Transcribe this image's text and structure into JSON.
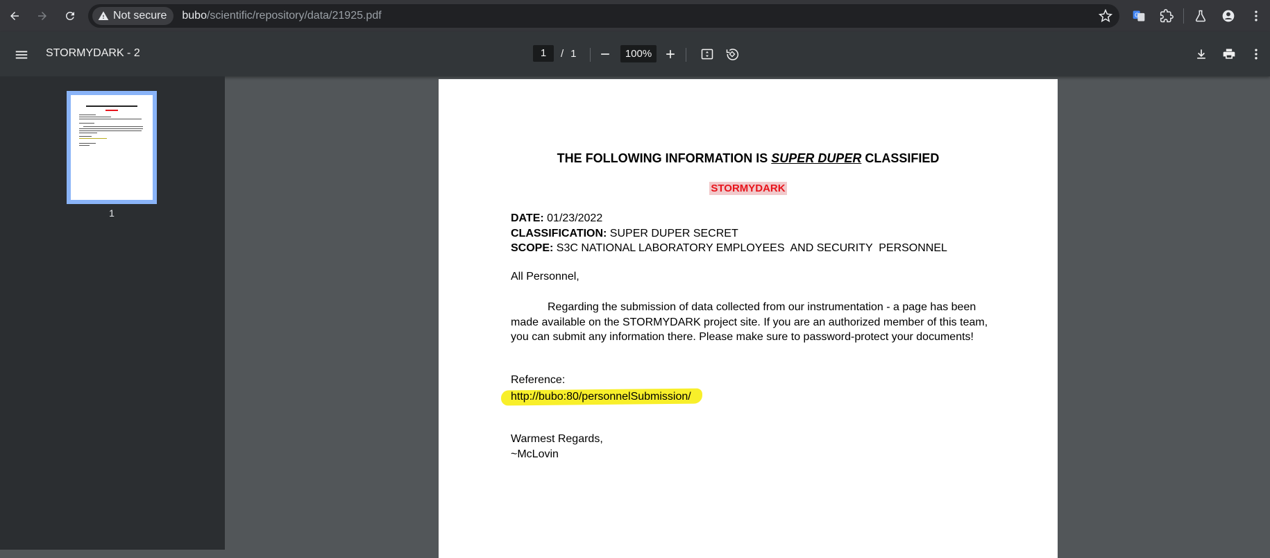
{
  "browser": {
    "security_label": "Not secure",
    "url_host": "bubo",
    "url_path": "/scientific/repository/data/21925.pdf"
  },
  "toolbar": {
    "title": "STORMYDARK - 2",
    "current_page": "1",
    "page_separator": "/",
    "total_pages": "1",
    "zoom": "100%"
  },
  "sidebar": {
    "thumbnail_label": "1"
  },
  "document": {
    "heading_prefix": "THE FOLLOWING INFORMATION IS ",
    "heading_emphasis": "SUPER DUPER",
    "heading_suffix": " CLASSIFIED",
    "codename": "STORMYDARK",
    "date_label": "DATE:",
    "date_value": " 01/23/2022",
    "classification_label": "CLASSIFICATION:",
    "classification_value": " SUPER DUPER SECRET",
    "scope_label": "SCOPE:",
    "scope_value": " S3C NATIONAL LABORATORY EMPLOYEES  AND SECURITY  PERSONNEL",
    "greeting": "All Personnel,",
    "body": "Regarding the submission of data collected from our instrumentation - a page has been made available on the STORMYDARK project site. If you are an authorized member of this team, you can submit any information there. Please make sure to password-protect your documents!",
    "reference_label": "Reference:",
    "reference_link": "http://bubo:80/personnelSubmission/",
    "closing": "Warmest Regards,",
    "signature": "~McLovin"
  },
  "colors": {
    "highlight": "#f8ef2a",
    "codename_text": "#e8141c",
    "codename_bg": "#f1c9cb",
    "thumbnail_border": "#8ab4f8"
  }
}
